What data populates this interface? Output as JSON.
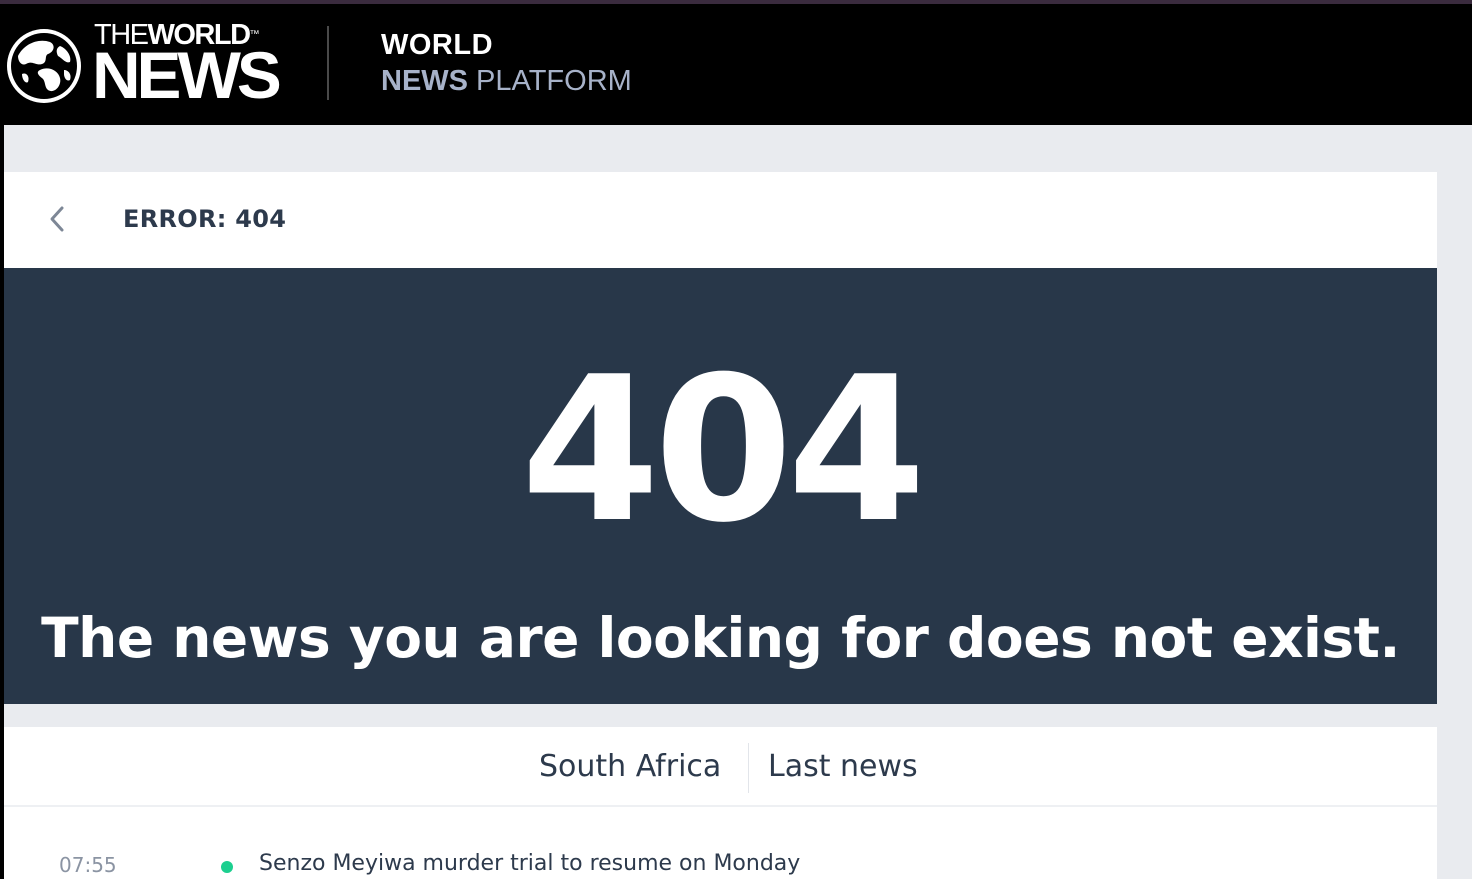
{
  "header": {
    "logo": {
      "top_prefix": "THE",
      "top_word": "WORLD",
      "trademark": "™",
      "bottom_word": "NEWS"
    },
    "platform": {
      "line1": "WORLD",
      "line2_bold": "NEWS",
      "line2_rest": " PLATFORM"
    }
  },
  "error_bar": {
    "back_icon": "chevron-left-icon",
    "title": "ERROR: 404"
  },
  "hero": {
    "code": "404",
    "message": "The news you are looking for does not exist."
  },
  "news_panel": {
    "tabs": [
      {
        "label": "South Africa"
      },
      {
        "label": "Last news"
      }
    ],
    "items": [
      {
        "time": "07:55",
        "headline": "Senzo Meyiwa murder trial to resume on Monday",
        "dot_color": "#1ccf8f"
      }
    ]
  },
  "colors": {
    "header_bg": "#000000",
    "page_bg": "#e9ebef",
    "hero_bg": "#283749",
    "text_dark": "#2d3a4c",
    "platform_accent": "#a7b2c9"
  }
}
